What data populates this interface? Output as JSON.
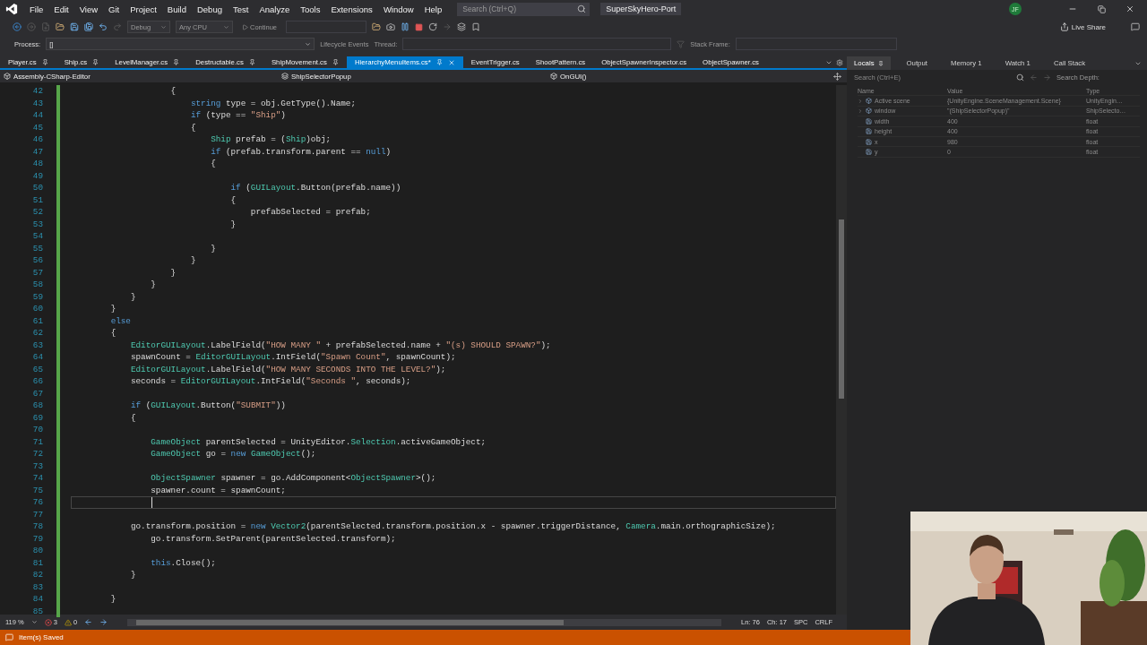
{
  "menu": {
    "items": [
      "File",
      "Edit",
      "View",
      "Git",
      "Project",
      "Build",
      "Debug",
      "Test",
      "Analyze",
      "Tools",
      "Extensions",
      "Window",
      "Help"
    ]
  },
  "search": {
    "placeholder": "Search (Ctrl+Q)"
  },
  "window": {
    "title": "SuperSkyHero-Port",
    "user_initials": "JF"
  },
  "toolbar": {
    "configuration": {
      "value": "Debug",
      "disabled": true
    },
    "platform": {
      "value": "Any CPU",
      "disabled": true
    },
    "continue": {
      "label": "Continue",
      "disabled": true
    },
    "live_share": "Live Share"
  },
  "debug_location": {
    "process_label": "Process:",
    "process_value": "[]",
    "lifecycle": "Lifecycle Events",
    "thread_label": "Thread:",
    "stack_frame_label": "Stack Frame:"
  },
  "editor_tabs": [
    {
      "label": "Player.cs",
      "pinned": true,
      "selected": false
    },
    {
      "label": "Ship.cs",
      "pinned": true,
      "selected": false
    },
    {
      "label": "LevelManager.cs",
      "pinned": true,
      "selected": false
    },
    {
      "label": "Destructable.cs",
      "pinned": true,
      "selected": false
    },
    {
      "label": "ShipMovement.cs",
      "pinned": true,
      "selected": false
    },
    {
      "label": "HierarchyMenuItems.cs*",
      "pinned": true,
      "selected": true
    },
    {
      "label": "EventTrigger.cs",
      "pinned": false,
      "selected": false
    },
    {
      "label": "ShootPattern.cs",
      "pinned": false,
      "selected": false
    },
    {
      "label": "ObjectSpawnerInspector.cs",
      "pinned": false,
      "selected": false
    },
    {
      "label": "ObjectSpawner.cs",
      "pinned": false,
      "selected": false
    }
  ],
  "nav_bar": {
    "project": "Assembly-CSharp-Editor",
    "type": "ShipSelectorPopup",
    "member": "OnGUI()"
  },
  "code_lines": [
    {
      "number": "42",
      "current": false,
      "tokens": [
        {
          "text": "                    {",
          "kind": "plain"
        }
      ]
    },
    {
      "number": "43",
      "current": false,
      "tokens": [
        {
          "text": "                        string",
          "kind": "keyword"
        },
        {
          "text": " type = obj.GetType().Name;",
          "kind": "plain"
        }
      ]
    },
    {
      "number": "44",
      "current": false,
      "tokens": [
        {
          "text": "                        if",
          "kind": "keyword"
        },
        {
          "text": " (type == ",
          "kind": "plain"
        },
        {
          "text": "\"Ship\"",
          "kind": "string"
        },
        {
          "text": ")",
          "kind": "plain"
        }
      ]
    },
    {
      "number": "45",
      "current": false,
      "tokens": [
        {
          "text": "                        {",
          "kind": "plain"
        }
      ]
    },
    {
      "number": "46",
      "current": false,
      "tokens": [
        {
          "text": "                            Ship",
          "kind": "type"
        },
        {
          "text": " prefab = (",
          "kind": "plain"
        },
        {
          "text": "Ship",
          "kind": "type"
        },
        {
          "text": ")obj;",
          "kind": "plain"
        }
      ]
    },
    {
      "number": "47",
      "current": false,
      "tokens": [
        {
          "text": "                            if",
          "kind": "keyword"
        },
        {
          "text": " (prefab.transform.parent == ",
          "kind": "plain"
        },
        {
          "text": "null",
          "kind": "keyword"
        },
        {
          "text": ")",
          "kind": "plain"
        }
      ]
    },
    {
      "number": "48",
      "current": false,
      "tokens": [
        {
          "text": "                            {",
          "kind": "plain"
        }
      ]
    },
    {
      "number": "49",
      "current": false
    },
    {
      "number": "50",
      "current": false,
      "tokens": [
        {
          "text": "                                if",
          "kind": "keyword"
        },
        {
          "text": " (",
          "kind": "plain"
        },
        {
          "text": "GUILayout",
          "kind": "type"
        },
        {
          "text": ".Button(prefab.name))",
          "kind": "plain"
        }
      ]
    },
    {
      "number": "51",
      "current": false,
      "tokens": [
        {
          "text": "                                {",
          "kind": "plain"
        }
      ]
    },
    {
      "number": "52",
      "current": false,
      "tokens": [
        {
          "text": "                                    prefabSelected = prefab;",
          "kind": "plain"
        }
      ]
    },
    {
      "number": "53",
      "current": false,
      "tokens": [
        {
          "text": "                                }",
          "kind": "plain"
        }
      ]
    },
    {
      "number": "54",
      "current": false
    },
    {
      "number": "55",
      "current": false,
      "tokens": [
        {
          "text": "                            }",
          "kind": "plain"
        }
      ]
    },
    {
      "number": "56",
      "current": false,
      "tokens": [
        {
          "text": "                        }",
          "kind": "plain"
        }
      ]
    },
    {
      "number": "57",
      "current": false,
      "tokens": [
        {
          "text": "                    }",
          "kind": "plain"
        }
      ]
    },
    {
      "number": "58",
      "current": false,
      "tokens": [
        {
          "text": "                }",
          "kind": "plain"
        }
      ]
    },
    {
      "number": "59",
      "current": false,
      "tokens": [
        {
          "text": "            }",
          "kind": "plain"
        }
      ]
    },
    {
      "number": "60",
      "current": false,
      "tokens": [
        {
          "text": "        }",
          "kind": "plain"
        }
      ]
    },
    {
      "number": "61",
      "current": false,
      "tokens": [
        {
          "text": "        else",
          "kind": "keyword"
        }
      ]
    },
    {
      "number": "62",
      "current": false,
      "tokens": [
        {
          "text": "        {",
          "kind": "plain"
        }
      ]
    },
    {
      "number": "63",
      "current": false,
      "tokens": [
        {
          "text": "            EditorGUILayout",
          "kind": "type"
        },
        {
          "text": ".LabelField(",
          "kind": "plain"
        },
        {
          "text": "\"HOW MANY \"",
          "kind": "string"
        },
        {
          "text": " + prefabSelected.name + ",
          "kind": "plain"
        },
        {
          "text": "\"(s) SHOULD SPAWN?\"",
          "kind": "string"
        },
        {
          "text": ");",
          "kind": "plain"
        }
      ]
    },
    {
      "number": "64",
      "current": false,
      "tokens": [
        {
          "text": "            spawnCount = ",
          "kind": "plain"
        },
        {
          "text": "EditorGUILayout",
          "kind": "type"
        },
        {
          "text": ".IntField(",
          "kind": "plain"
        },
        {
          "text": "\"Spawn Count\"",
          "kind": "string"
        },
        {
          "text": ", spawnCount);",
          "kind": "plain"
        }
      ]
    },
    {
      "number": "65",
      "current": false,
      "tokens": [
        {
          "text": "            EditorGUILayout",
          "kind": "type"
        },
        {
          "text": ".LabelField(",
          "kind": "plain"
        },
        {
          "text": "\"HOW MANY SECONDS INTO THE LEVEL?\"",
          "kind": "string"
        },
        {
          "text": ");",
          "kind": "plain"
        }
      ]
    },
    {
      "number": "66",
      "current": false,
      "tokens": [
        {
          "text": "            seconds = ",
          "kind": "plain"
        },
        {
          "text": "EditorGUILayout",
          "kind": "type"
        },
        {
          "text": ".IntField(",
          "kind": "plain"
        },
        {
          "text": "\"Seconds \"",
          "kind": "string"
        },
        {
          "text": ", seconds);",
          "kind": "plain"
        }
      ]
    },
    {
      "number": "67",
      "current": false
    },
    {
      "number": "68",
      "current": false,
      "tokens": [
        {
          "text": "            if",
          "kind": "keyword"
        },
        {
          "text": " (",
          "kind": "plain"
        },
        {
          "text": "GUILayout",
          "kind": "type"
        },
        {
          "text": ".Button(",
          "kind": "plain"
        },
        {
          "text": "\"SUBMIT\"",
          "kind": "string"
        },
        {
          "text": "))",
          "kind": "plain"
        }
      ]
    },
    {
      "number": "69",
      "current": false,
      "tokens": [
        {
          "text": "            {",
          "kind": "plain"
        }
      ]
    },
    {
      "number": "70",
      "current": false
    },
    {
      "number": "71",
      "current": false,
      "tokens": [
        {
          "text": "                GameObject",
          "kind": "type"
        },
        {
          "text": " parentSelected = UnityEditor.",
          "kind": "plain"
        },
        {
          "text": "Selection",
          "kind": "type"
        },
        {
          "text": ".activeGameObject;",
          "kind": "plain"
        }
      ]
    },
    {
      "number": "72",
      "current": false,
      "tokens": [
        {
          "text": "                GameObject",
          "kind": "type"
        },
        {
          "text": " go = ",
          "kind": "plain"
        },
        {
          "text": "new",
          "kind": "keyword"
        },
        {
          "text": " GameObject",
          "kind": "type"
        },
        {
          "text": "();",
          "kind": "plain"
        }
      ]
    },
    {
      "number": "73",
      "current": false
    },
    {
      "number": "74",
      "current": false,
      "tokens": [
        {
          "text": "                ObjectSpawner",
          "kind": "type"
        },
        {
          "text": " spawner = go.AddComponent<",
          "kind": "plain"
        },
        {
          "text": "ObjectSpawner",
          "kind": "type"
        },
        {
          "text": ">();",
          "kind": "plain"
        }
      ]
    },
    {
      "number": "75",
      "current": false,
      "tokens": [
        {
          "text": "                spawner.count = spawnCount;",
          "kind": "plain"
        }
      ]
    },
    {
      "number": "76",
      "current": true
    },
    {
      "number": "77",
      "current": false
    },
    {
      "number": "78",
      "current": false,
      "tokens": [
        {
          "text": "            go.transform.position = ",
          "kind": "plain"
        },
        {
          "text": "new",
          "kind": "keyword"
        },
        {
          "text": " Vector2",
          "kind": "type"
        },
        {
          "text": "(parentSelected.transform.position.x - spawner.triggerDistance, ",
          "kind": "plain"
        },
        {
          "text": "Camera",
          "kind": "type"
        },
        {
          "text": ".main.orthographicSize);",
          "kind": "plain"
        }
      ]
    },
    {
      "number": "79",
      "current": false,
      "tokens": [
        {
          "text": "                go.transform.SetParent(parentSelected.transform);",
          "kind": "plain"
        }
      ]
    },
    {
      "number": "80",
      "current": false
    },
    {
      "number": "81",
      "current": false,
      "tokens": [
        {
          "text": "                this",
          "kind": "keyword"
        },
        {
          "text": ".Close();",
          "kind": "plain"
        }
      ]
    },
    {
      "number": "82",
      "current": false,
      "tokens": [
        {
          "text": "            }",
          "kind": "plain"
        }
      ]
    },
    {
      "number": "83",
      "current": false
    },
    {
      "number": "84",
      "current": false,
      "tokens": [
        {
          "text": "        }",
          "kind": "plain"
        }
      ]
    },
    {
      "number": "85",
      "current": false
    }
  ],
  "editor_status": {
    "zoom": "119 %",
    "errors": "3",
    "warnings": "0",
    "line": "Ln: 76",
    "column": "Ch: 17",
    "whitespace": "SPC",
    "line_endings": "CRLF"
  },
  "tool_window": {
    "tabs": [
      {
        "label": "Locals",
        "selected": true
      },
      {
        "label": "Output",
        "selected": false
      },
      {
        "label": "Memory 1",
        "selected": false
      },
      {
        "label": "Watch 1",
        "selected": false
      },
      {
        "label": "Call Stack",
        "selected": false
      }
    ],
    "search": {
      "placeholder": "Search (Ctrl+E)"
    },
    "search_depth": "Search Depth:",
    "columns": [
      "Name",
      "Value",
      "Type"
    ],
    "rows": [
      {
        "kind": "object",
        "name": "Active scene",
        "value": "{UnityEngine.SceneManagement.Scene}",
        "type": "UnityEngin…"
      },
      {
        "kind": "object",
        "name": "window",
        "value": "\"(ShipSelectorPopup)\"",
        "type": "ShipSelecto…"
      },
      {
        "kind": "field",
        "name": "width",
        "value": "400",
        "type": "float"
      },
      {
        "kind": "field",
        "name": "height",
        "value": "400",
        "type": "float"
      },
      {
        "kind": "field",
        "name": "x",
        "value": "980",
        "type": "float"
      },
      {
        "kind": "field",
        "name": "y",
        "value": "0",
        "type": "float"
      }
    ]
  },
  "status_bar": {
    "message": "Item(s) Saved"
  }
}
